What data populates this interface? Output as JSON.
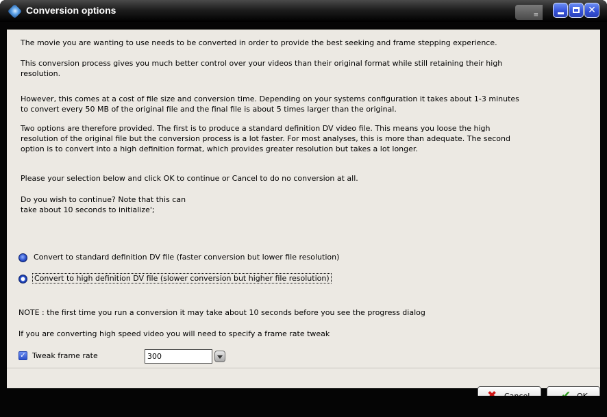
{
  "window": {
    "title": "Conversion options",
    "title_strip_text": "≡"
  },
  "title_buttons": {
    "minimize": "",
    "maximize": "",
    "close": "✕"
  },
  "message": {
    "p1": "The movie you are wanting to use needs to be converted in order to provide the best seeking and frame stepping experience.",
    "p2_line1": "This conversion process gives you much better control over your videos than their original format while still retaining their high",
    "p2_line2": "resolution.",
    "p3_line1": "However, this comes at a cost of file size and conversion time. Depending on your systems configuration it takes about 1-3 minutes",
    "p3_line2": "to convert every 50 MB of the original file and the final file is about 5 times larger than the original.",
    "p4_line1": "Two options are therefore provided. The first is to produce a standard definition DV video file. This means you loose the high",
    "p4_line2": "resolution of the original file but the conversion process is a lot faster. For most analyses, this is more than adequate. The second",
    "p4_line3": "option is to convert into a high definition format, which provides greater resolution but takes a lot longer.",
    "p5": "Please your selection below and click OK to continue or Cancel to do no conversion at all.",
    "p6": "Do you wish to continue? Note that this can",
    "p7": "take about 10 seconds to initialize';"
  },
  "options": {
    "standard_label": "Convert to standard definition DV file (faster conversion but lower file resolution)",
    "high_label": "Convert to high definition DV file (slower conversion but higher file resolution)",
    "selected": "standard"
  },
  "notes": {
    "note1": "NOTE : the first time you run a conversion it may take about 10 seconds before you see the progress dialog",
    "note2": "If you are converting high speed video you will need to specify a frame rate tweak"
  },
  "tweak": {
    "label": "Tweak frame rate",
    "checked": true,
    "value": "300"
  },
  "buttons": {
    "cancel_label": "Cancel",
    "ok_label": "OK"
  },
  "icons": {
    "app": "app-icon",
    "cancel": "red-x-icon",
    "ok": "green-check-icon"
  },
  "colors": {
    "dialog_bg": "#ece9e3",
    "titlebar": "#1e1e1e",
    "title_button": "#3552d8"
  }
}
